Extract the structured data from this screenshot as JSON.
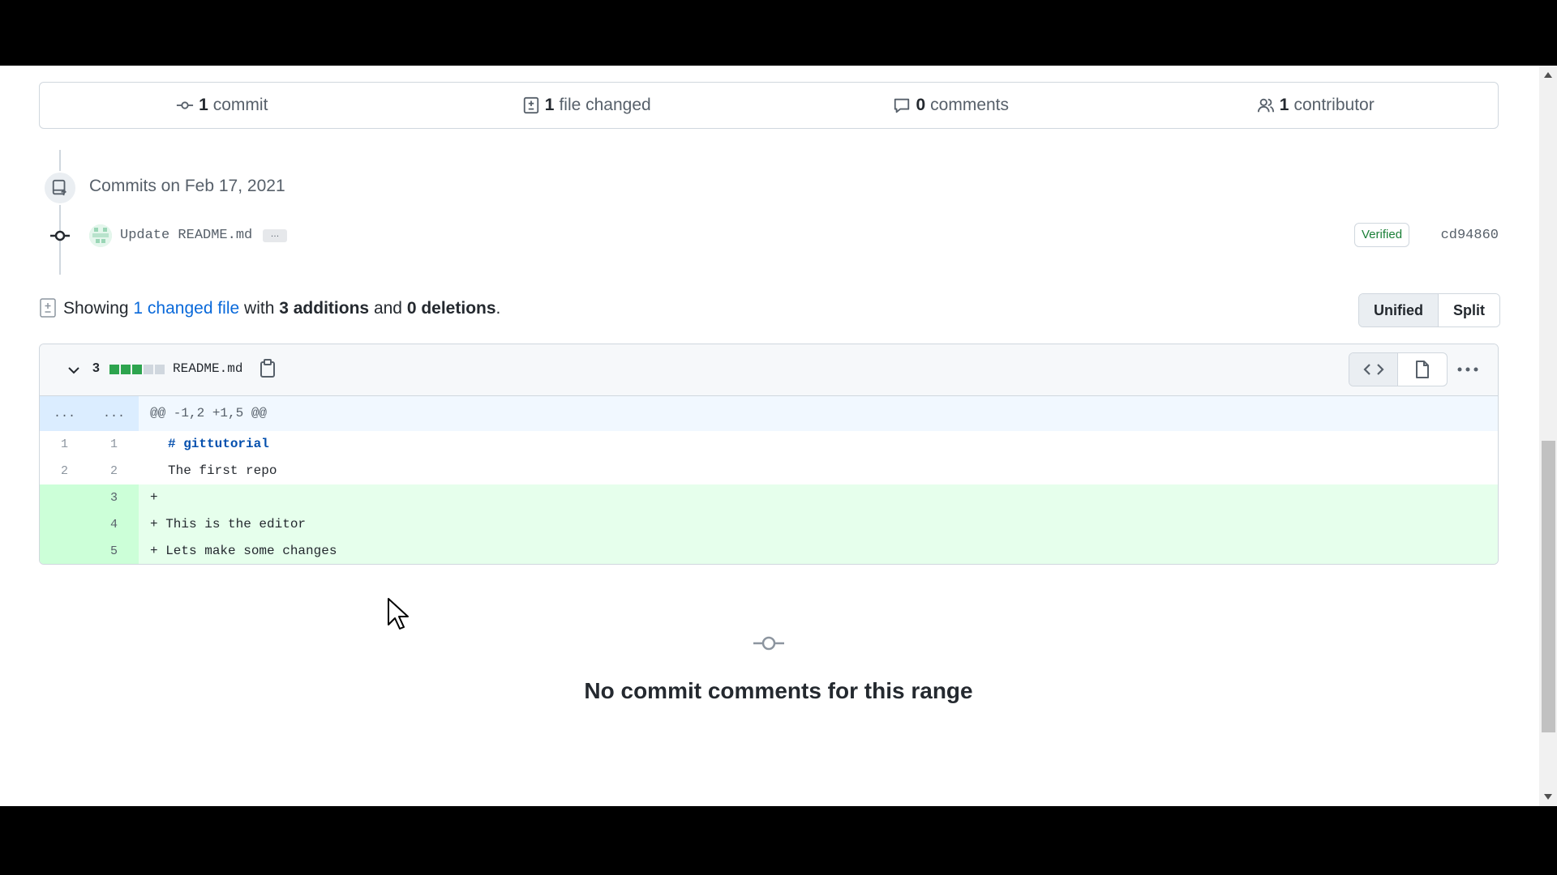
{
  "summary": {
    "commits": {
      "count": "1",
      "label": "commit",
      "icon": "git-commit-icon"
    },
    "files": {
      "count": "1",
      "label": "file changed",
      "icon": "file-diff-icon"
    },
    "comments": {
      "count": "0",
      "label": "comments",
      "icon": "comment-icon"
    },
    "contributors": {
      "count": "1",
      "label": "contributor",
      "icon": "people-icon"
    }
  },
  "commits_group": {
    "heading": "Commits on Feb 17, 2021",
    "commits": [
      {
        "message": "Update README.md",
        "expander": "…",
        "badge": "Verified",
        "sha": "cd94860"
      }
    ]
  },
  "diff_toolbar": {
    "prefix": "Showing",
    "changed_files_link": "1 changed file",
    "with": "with",
    "additions": "3 additions",
    "and": "and",
    "deletions": "0 deletions",
    "period": ".",
    "views": {
      "unified": "Unified",
      "split": "Split",
      "selected": "Unified"
    }
  },
  "file": {
    "changes": "3",
    "diffstat": {
      "additions": 3,
      "deletions": 0
    },
    "name": "README.md",
    "lines": [
      {
        "type": "hunk",
        "old": "...",
        "new": "...",
        "code": "@@ -1,2 +1,5 @@"
      },
      {
        "type": "ctx",
        "old": "1",
        "new": "1",
        "code": "# gittutorial"
      },
      {
        "type": "ctx",
        "old": "2",
        "new": "2",
        "code": "The first repo"
      },
      {
        "type": "add",
        "old": "",
        "new": "3",
        "code": "+"
      },
      {
        "type": "add",
        "old": "",
        "new": "4",
        "code": "+ This is the editor"
      },
      {
        "type": "add",
        "old": "",
        "new": "5",
        "code": "+ Lets make some changes"
      }
    ]
  },
  "comments_section": {
    "empty_text": "No commit comments for this range"
  },
  "colors": {
    "addition_green": "#2da44e",
    "link_blue": "#0969da",
    "verified_green": "#1a7f37"
  }
}
